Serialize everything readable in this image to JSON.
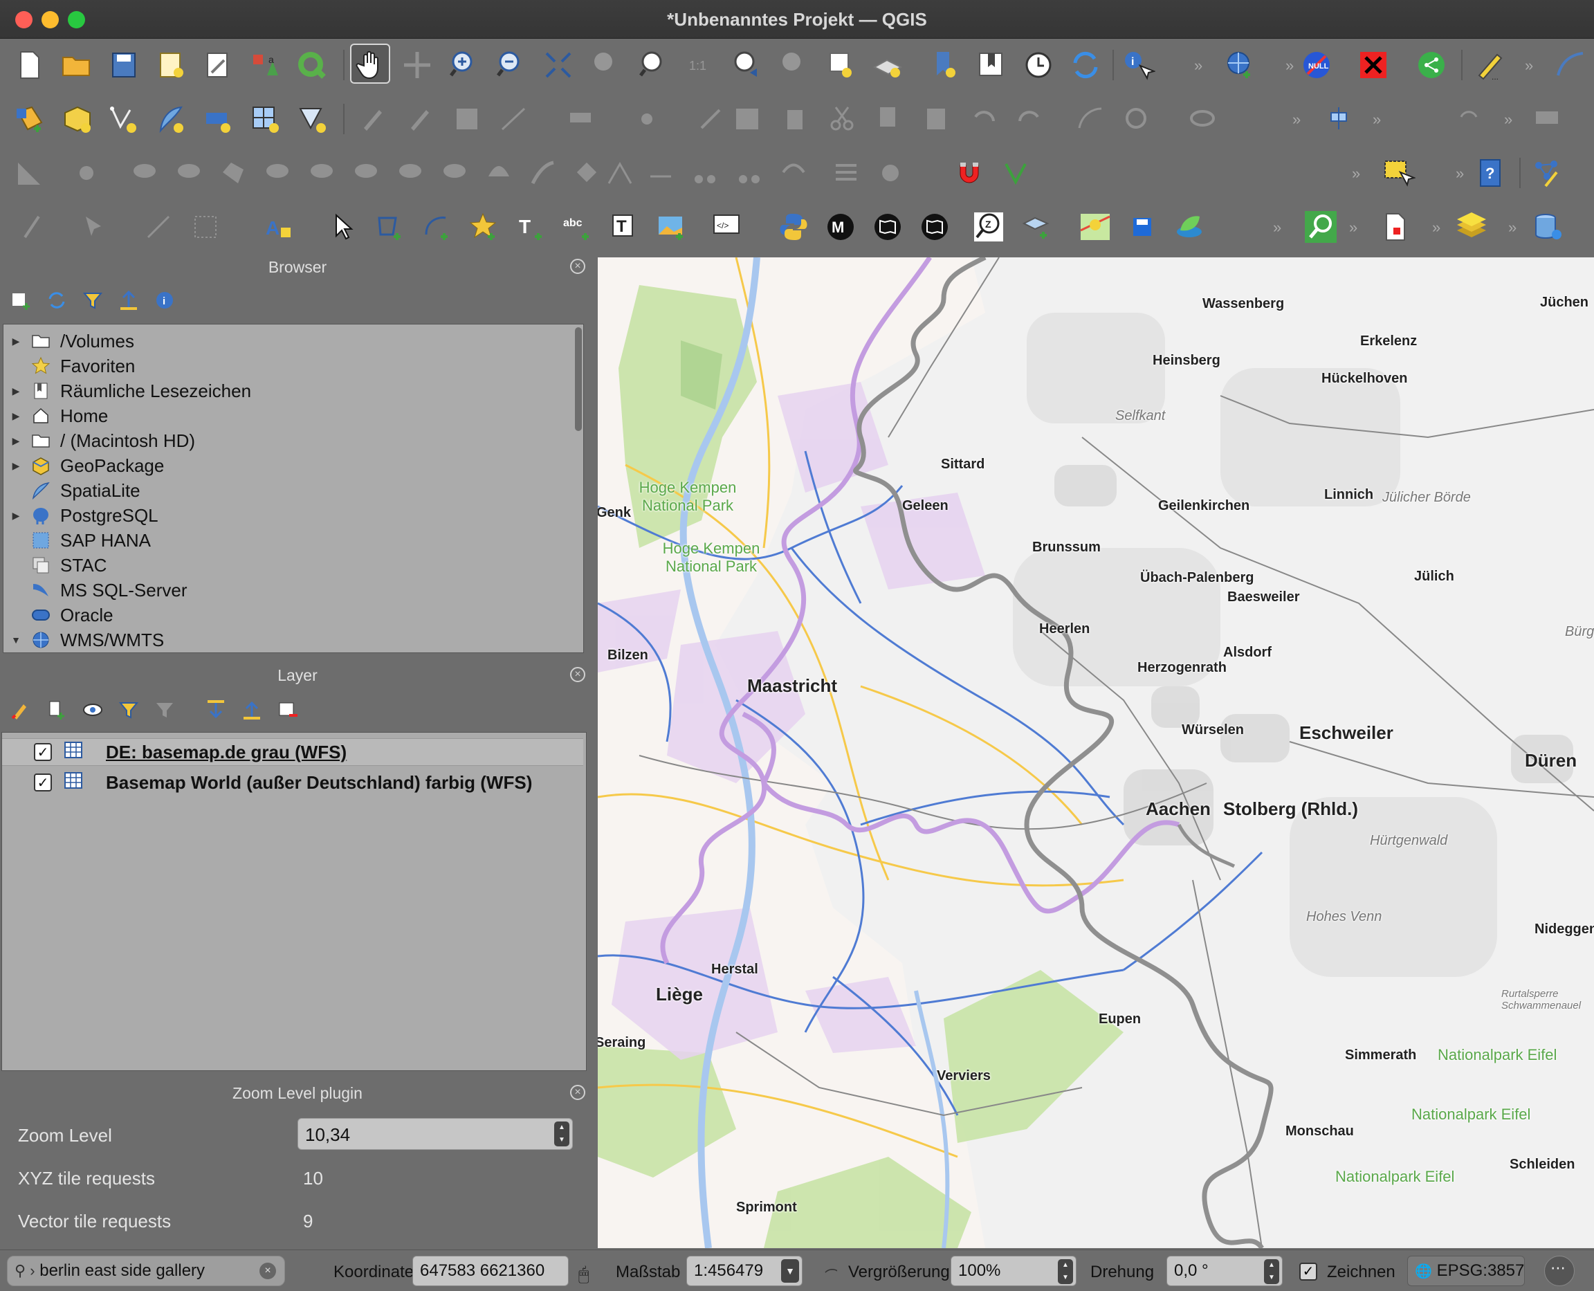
{
  "window": {
    "title": "*Unbenanntes Projekt — QGIS"
  },
  "colors": {
    "accent": "#3a8ee6",
    "panel_bg": "#6d6d6d",
    "tree_bg": "#ababab",
    "map_bg": "#f8f4f1",
    "border_purple": "#b880d8",
    "border_gray": "#8a8a8a"
  },
  "toolbar": {
    "snapping_tolerance": "12"
  },
  "browser": {
    "title": "Browser",
    "items": [
      {
        "label": "/Volumes",
        "icon": "folder-icon",
        "expand": "▶"
      },
      {
        "label": "Favoriten",
        "icon": "star-icon",
        "expand": ""
      },
      {
        "label": "Räumliche Lesezeichen",
        "icon": "bookmark-icon",
        "expand": "▶"
      },
      {
        "label": "Home",
        "icon": "home-icon",
        "expand": "▶"
      },
      {
        "label": "/ (Macintosh HD)",
        "icon": "folder-icon",
        "expand": "▶"
      },
      {
        "label": "GeoPackage",
        "icon": "geopackage-icon",
        "expand": "▶"
      },
      {
        "label": "SpatiaLite",
        "icon": "feather-icon",
        "expand": ""
      },
      {
        "label": "PostgreSQL",
        "icon": "elephant-icon",
        "expand": "▶"
      },
      {
        "label": "SAP HANA",
        "icon": "sap-hana-icon",
        "expand": ""
      },
      {
        "label": "STAC",
        "icon": "stac-icon",
        "expand": ""
      },
      {
        "label": "MS SQL-Server",
        "icon": "mssql-icon",
        "expand": ""
      },
      {
        "label": "Oracle",
        "icon": "oracle-icon",
        "expand": ""
      },
      {
        "label": "WMS/WMTS",
        "icon": "globe-icon",
        "expand": "▼"
      }
    ]
  },
  "layers": {
    "title": "Layer",
    "items": [
      {
        "label": "DE: basemap.de grau (WFS)",
        "checked": true,
        "selected": true
      },
      {
        "label": "Basemap World (außer Deutschland) farbig (WFS)",
        "checked": true,
        "selected": false
      }
    ]
  },
  "zoom_plugin": {
    "title": "Zoom Level plugin",
    "zoom_level_label": "Zoom Level",
    "zoom_level_value": "10,34",
    "xyz_label": "XYZ tile requests",
    "xyz_value": "10",
    "vector_label": "Vector tile requests",
    "vector_value": "9"
  },
  "map": {
    "labels": [
      {
        "text": "Wassenberg"
      },
      {
        "text": "Jüchen"
      },
      {
        "text": "Erkelenz"
      },
      {
        "text": "Heinsberg"
      },
      {
        "text": "Hückelhoven"
      },
      {
        "text": "Selfkant"
      },
      {
        "text": "Sittard"
      },
      {
        "text": "Hoge Kempen National Park"
      },
      {
        "text": "Genk"
      },
      {
        "text": "Geleen"
      },
      {
        "text": "Geilenkirchen"
      },
      {
        "text": "Linnich"
      },
      {
        "text": "Jülicher Börde"
      },
      {
        "text": "Hoge Kempen National Park"
      },
      {
        "text": "Brunssum"
      },
      {
        "text": "Übach-Palenberg"
      },
      {
        "text": "Jülich"
      },
      {
        "text": "Baesweiler"
      },
      {
        "text": "Heerlen"
      },
      {
        "text": "Bürge"
      },
      {
        "text": "Bilzen"
      },
      {
        "text": "Alsdorf"
      },
      {
        "text": "Herzogenrath"
      },
      {
        "text": "Maastricht"
      },
      {
        "text": "Würselen"
      },
      {
        "text": "Eschweiler"
      },
      {
        "text": "Düren"
      },
      {
        "text": "Aachen"
      },
      {
        "text": "Stolberg (Rhld.)"
      },
      {
        "text": "Hürtgenwald"
      },
      {
        "text": "Hohes Venn"
      },
      {
        "text": "Nideggen"
      },
      {
        "text": "Herstal"
      },
      {
        "text": "Liège"
      },
      {
        "text": "Rurtalsperre Schwammenauel"
      },
      {
        "text": "Eupen"
      },
      {
        "text": "Seraing"
      },
      {
        "text": "Simmerath"
      },
      {
        "text": "Nationalpark Eifel"
      },
      {
        "text": "Verviers"
      },
      {
        "text": "Nationalpark Eifel"
      },
      {
        "text": "Monschau"
      },
      {
        "text": "Schleiden"
      },
      {
        "text": "Nationalpark Eifel"
      },
      {
        "text": "Sprimont"
      }
    ]
  },
  "statusbar": {
    "search_value": "berlin east side gallery",
    "coord_label": "Koordinate",
    "coord_value": "647583  6621360",
    "scale_label": "Maßstab",
    "scale_value": "1:456479",
    "magnifier_label": "Vergrößerung",
    "magnifier_value": "100%",
    "rotation_label": "Drehung",
    "rotation_value": "0,0 °",
    "render_label": "Zeichnen",
    "crs_value": "EPSG:3857"
  }
}
